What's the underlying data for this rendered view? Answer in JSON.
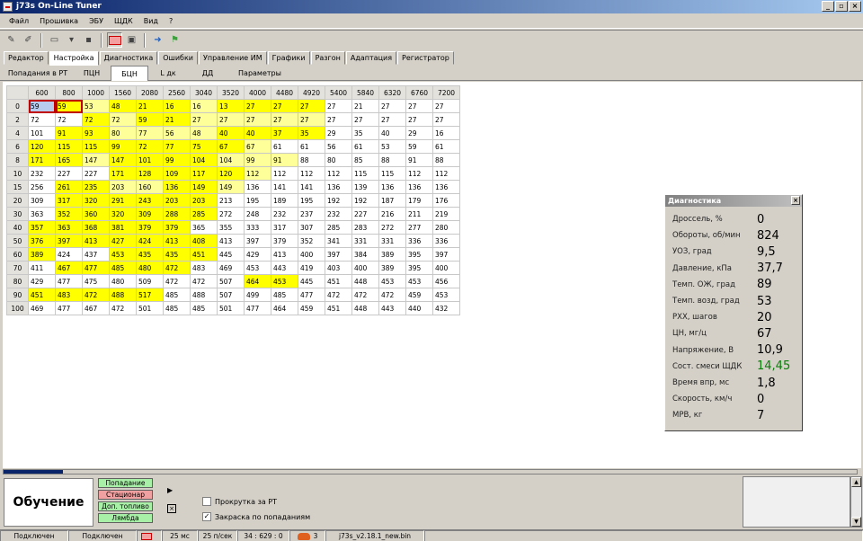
{
  "window": {
    "title": "j73s On-Line Tuner",
    "min": "_",
    "max": "▫",
    "close": "×"
  },
  "menu": [
    "Файл",
    "Прошивка",
    "ЭБУ",
    "ЩДК",
    "Вид",
    "?"
  ],
  "main_tabs": [
    "Редактор",
    "Настройка",
    "Диагностика",
    "Ошибки",
    "Управление ИМ",
    "Графики",
    "Разгон",
    "Адаптация",
    "Регистратор"
  ],
  "main_tab_active": 1,
  "sub_tabs": [
    "Попадания в РТ",
    "ПЦН",
    "БЦН",
    "L дк",
    "ДД",
    "Параметры"
  ],
  "sub_tab_active": 2,
  "grid": {
    "columns": [
      "600",
      "800",
      "1000",
      "1560",
      "2080",
      "2560",
      "3040",
      "3520",
      "4000",
      "4480",
      "4920",
      "5400",
      "5840",
      "6320",
      "6760",
      "7200"
    ],
    "rows": [
      {
        "label": "0",
        "cells": [
          "59",
          "59",
          "53",
          "48",
          "21",
          "16",
          "16",
          "13",
          "27",
          "27",
          "27",
          "27",
          "21",
          "27",
          "27",
          "27"
        ]
      },
      {
        "label": "2",
        "cells": [
          "72",
          "72",
          "72",
          "72",
          "59",
          "21",
          "27",
          "27",
          "27",
          "27",
          "27",
          "27",
          "27",
          "27",
          "27",
          "27"
        ]
      },
      {
        "label": "4",
        "cells": [
          "101",
          "91",
          "93",
          "80",
          "77",
          "56",
          "48",
          "40",
          "40",
          "37",
          "35",
          "29",
          "35",
          "40",
          "29",
          "16"
        ]
      },
      {
        "label": "6",
        "cells": [
          "120",
          "115",
          "115",
          "99",
          "72",
          "77",
          "75",
          "67",
          "67",
          "61",
          "61",
          "56",
          "61",
          "53",
          "59",
          "61"
        ]
      },
      {
        "label": "8",
        "cells": [
          "171",
          "165",
          "147",
          "147",
          "101",
          "99",
          "104",
          "104",
          "99",
          "91",
          "88",
          "80",
          "85",
          "88",
          "91",
          "88"
        ]
      },
      {
        "label": "10",
        "cells": [
          "232",
          "227",
          "227",
          "171",
          "128",
          "109",
          "117",
          "120",
          "112",
          "112",
          "112",
          "112",
          "115",
          "115",
          "112",
          "112"
        ]
      },
      {
        "label": "15",
        "cells": [
          "256",
          "261",
          "235",
          "203",
          "160",
          "136",
          "149",
          "149",
          "136",
          "141",
          "141",
          "136",
          "139",
          "136",
          "136",
          "136"
        ]
      },
      {
        "label": "20",
        "cells": [
          "309",
          "317",
          "320",
          "291",
          "243",
          "203",
          "203",
          "213",
          "195",
          "189",
          "195",
          "192",
          "192",
          "187",
          "179",
          "176"
        ]
      },
      {
        "label": "30",
        "cells": [
          "363",
          "352",
          "360",
          "320",
          "309",
          "288",
          "285",
          "272",
          "248",
          "232",
          "237",
          "232",
          "227",
          "216",
          "211",
          "219"
        ]
      },
      {
        "label": "40",
        "cells": [
          "357",
          "363",
          "368",
          "381",
          "379",
          "379",
          "365",
          "355",
          "333",
          "317",
          "307",
          "285",
          "283",
          "272",
          "277",
          "280"
        ]
      },
      {
        "label": "50",
        "cells": [
          "376",
          "397",
          "413",
          "427",
          "424",
          "413",
          "408",
          "413",
          "397",
          "379",
          "352",
          "341",
          "331",
          "331",
          "336",
          "336"
        ]
      },
      {
        "label": "60",
        "cells": [
          "389",
          "424",
          "437",
          "453",
          "435",
          "435",
          "451",
          "445",
          "429",
          "413",
          "400",
          "397",
          "384",
          "389",
          "395",
          "397"
        ]
      },
      {
        "label": "70",
        "cells": [
          "411",
          "467",
          "477",
          "485",
          "480",
          "472",
          "483",
          "469",
          "453",
          "443",
          "419",
          "403",
          "400",
          "389",
          "395",
          "400"
        ]
      },
      {
        "label": "80",
        "cells": [
          "429",
          "477",
          "475",
          "480",
          "509",
          "472",
          "472",
          "507",
          "464",
          "453",
          "445",
          "451",
          "448",
          "453",
          "453",
          "456"
        ]
      },
      {
        "label": "90",
        "cells": [
          "451",
          "483",
          "472",
          "488",
          "517",
          "485",
          "488",
          "507",
          "499",
          "485",
          "477",
          "472",
          "472",
          "472",
          "459",
          "453"
        ]
      },
      {
        "label": "100",
        "cells": [
          "469",
          "477",
          "467",
          "472",
          "501",
          "485",
          "485",
          "501",
          "477",
          "464",
          "459",
          "451",
          "448",
          "443",
          "440",
          "432"
        ]
      }
    ],
    "highlight": [
      [
        "s",
        "s2",
        "l",
        "y",
        "y",
        "y",
        "l",
        "y",
        "y",
        "y",
        "y",
        "",
        "",
        "",
        "",
        ""
      ],
      [
        "",
        "",
        "y",
        "l",
        "y",
        "y",
        "l",
        "l",
        "l",
        "l",
        "l",
        "",
        "",
        "",
        "",
        ""
      ],
      [
        "",
        "y",
        "y",
        "l",
        "l",
        "l",
        "l",
        "y",
        "y",
        "y",
        "y",
        "",
        "",
        "",
        "",
        ""
      ],
      [
        "y",
        "y",
        "y",
        "y",
        "y",
        "y",
        "y",
        "y",
        "l",
        "",
        "",
        "",
        "",
        "",
        "",
        ""
      ],
      [
        "y",
        "y",
        "l",
        "y",
        "y",
        "y",
        "y",
        "l",
        "l",
        "l",
        "",
        "",
        "",
        "",
        "",
        ""
      ],
      [
        "",
        "",
        "",
        "y",
        "y",
        "y",
        "y",
        "y",
        "l",
        "",
        "",
        "",
        "",
        "",
        "",
        ""
      ],
      [
        "",
        "y",
        "y",
        "l",
        "l",
        "y",
        "y",
        "l",
        "",
        "",
        "",
        "",
        "",
        "",
        "",
        ""
      ],
      [
        "",
        "y",
        "y",
        "y",
        "y",
        "y",
        "y",
        "",
        "",
        "",
        "",
        "",
        "",
        "",
        "",
        ""
      ],
      [
        "",
        "y",
        "y",
        "y",
        "y",
        "y",
        "y",
        "",
        "",
        "",
        "",
        "",
        "",
        "",
        "",
        ""
      ],
      [
        "y",
        "y",
        "y",
        "y",
        "y",
        "y",
        "",
        "",
        "",
        "",
        "",
        "",
        "",
        "",
        "",
        ""
      ],
      [
        "y",
        "y",
        "y",
        "y",
        "y",
        "y",
        "y",
        "",
        "",
        "",
        "",
        "",
        "",
        "",
        "",
        ""
      ],
      [
        "y",
        "",
        "",
        "y",
        "y",
        "y",
        "y",
        "",
        "",
        "",
        "",
        "",
        "",
        "",
        "",
        ""
      ],
      [
        "",
        "y",
        "y",
        "y",
        "y",
        "y",
        "",
        "",
        "",
        "",
        "",
        "",
        "",
        "",
        "",
        ""
      ],
      [
        "",
        "",
        "",
        "",
        "",
        "",
        "",
        "",
        "y",
        "y",
        "",
        "",
        "",
        "",
        "",
        ""
      ],
      [
        "y",
        "y",
        "y",
        "y",
        "y",
        "",
        "",
        "",
        "",
        "",
        "",
        "",
        "",
        "",
        "",
        ""
      ],
      [
        "",
        "",
        "",
        "",
        "",
        "",
        "",
        "",
        "",
        "",
        "",
        "",
        "",
        "",
        "",
        ""
      ]
    ]
  },
  "diagnostics": {
    "title": "Диагностика",
    "close": "×",
    "items": [
      {
        "label": "Дроссель, %",
        "value": "0"
      },
      {
        "label": "Обороты, об/мин",
        "value": "824"
      },
      {
        "label": "УОЗ, град",
        "value": "9,5"
      },
      {
        "label": "Давление, кПа",
        "value": "37,7"
      },
      {
        "label": "Темп. ОЖ, град",
        "value": "89"
      },
      {
        "label": "Темп. возд, град",
        "value": "53"
      },
      {
        "label": "РХХ, шагов",
        "value": "20"
      },
      {
        "label": "ЦН, мг/ц",
        "value": "67"
      },
      {
        "label": "Напряжение, В",
        "value": "10,9"
      },
      {
        "label": "Сост. смеси ЩДК",
        "value": "14,45"
      },
      {
        "label": "Время впр, мс",
        "value": "1,8"
      },
      {
        "label": "Скорость, км/ч",
        "value": "0"
      },
      {
        "label": "МРВ, кг",
        "value": "7"
      }
    ]
  },
  "progress": {
    "fraction": 0.07
  },
  "learning": {
    "title": "Обучение",
    "indicators": [
      {
        "label": "Попадание",
        "state": "green"
      },
      {
        "label": "Стационар",
        "state": "red"
      },
      {
        "label": "Доп. топливо",
        "state": "green"
      },
      {
        "label": "Лямбда",
        "state": "green"
      }
    ],
    "arrow": "▶",
    "x_btn": "×"
  },
  "options": {
    "scroll_label": "Прокрутка за РТ",
    "scroll_checked": "",
    "color_label": "Закраска по попаданиям",
    "color_checked": "✓"
  },
  "status": {
    "s1": "Подключен",
    "s2": "Подключен",
    "s3": "25 мс",
    "s4": "25 п/сек",
    "s5": "34 : 629 : 0",
    "s6": "3",
    "s7": "j73s_v2.18.1_new.bin"
  }
}
